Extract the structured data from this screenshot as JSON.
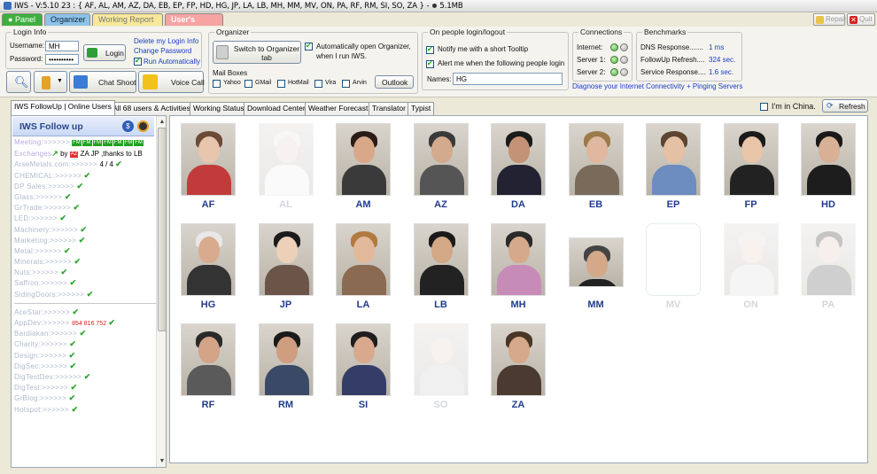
{
  "window": {
    "title": "IWS - V:5.10     23 : { AF, AL, AM, AZ, DA, EB, EP, FP, HD, HG, JP, LA, LB, MH, MM, MV, ON, PA, RF, RM, SI, SO, ZA }   -",
    "memory": "5.1MB",
    "repair": "Repair",
    "quit": "Quit"
  },
  "top_tabs": {
    "panel": "Panel",
    "organizer": "Organizer",
    "working_report": "Working Report",
    "users_manual": "User's Manual"
  },
  "login": {
    "group": "Login Info",
    "username_label": "Username:",
    "username_value": "MH",
    "password_label": "Password:",
    "password_value": "••••••••••",
    "login_button": "Login",
    "link_delete": "Delete my Login Info",
    "link_change": "Change Password",
    "run_auto": "Run Automatically"
  },
  "toolbar": {
    "chat_shoot": "Chat Shoot",
    "voice_call": "Voice Call"
  },
  "organizer": {
    "group": "Organizer",
    "switch_button": "Switch to Organizer tab",
    "auto_open": "Automatically open Organizer, when I run IWS.",
    "mailboxes_label": "Mail Boxes",
    "mailboxes": [
      "Yahoo",
      "GMail",
      "HotMail",
      "Vira",
      "Arvin"
    ],
    "outlook_button": "Outlook"
  },
  "people": {
    "group": "On people login/logout",
    "notify": "Notify me with a short Tooltip",
    "alert": "Alert me when the following people login",
    "names_label": "Names:",
    "names_value": "HG"
  },
  "connections": {
    "group": "Connections",
    "rows": [
      "Internet:",
      "Server 1:",
      "Server 2:"
    ]
  },
  "benchmarks": {
    "group": "Benchmarks",
    "rows": [
      {
        "label": "DNS Response.......",
        "value": "1 ms"
      },
      {
        "label": "FollowUp Refresh....",
        "value": "324 sec."
      },
      {
        "label": "Service Response....",
        "value": "1.6 sec."
      }
    ],
    "diagnose_link": "Diagnose your Internet Connectivity + Pinging Servers"
  },
  "lower_tabs": [
    "IWS FollowUp | Online Users",
    "All 68 users & Activities",
    "Working Status",
    "Download Center",
    "Weather Forecast",
    "Translator",
    "Typist"
  ],
  "china_label": "I'm in China.",
  "refresh_button": "Refresh",
  "followup": {
    "header": "IWS Follow up",
    "meeting_label": "Meeting:",
    "meeting_arrows": ">>>>>>",
    "exchanges_label": "Exchanges",
    "exchanges_text": " by ",
    "exchanges_badge": "AZ",
    "exchanges_rest": " ZA JP ,thanks to LB",
    "top_items": [
      {
        "label": "ArseMetals.com:",
        "value": "4 / 4"
      },
      {
        "label": "CHEMICAL:"
      },
      {
        "label": "DP Sales:"
      },
      {
        "label": "Glass:"
      },
      {
        "label": "GrTrade:"
      },
      {
        "label": "LED:"
      },
      {
        "label": "Machinery:"
      },
      {
        "label": "Marketing:"
      },
      {
        "label": "Metal:"
      },
      {
        "label": "Minerals:"
      },
      {
        "label": "Nuts:"
      },
      {
        "label": "Saffron:"
      },
      {
        "label": "SidingDoors:"
      }
    ],
    "bottom_items": [
      {
        "label": "AceStar:"
      },
      {
        "label": "AppDev:",
        "value": "854 816 752"
      },
      {
        "label": "Bardiakan:"
      },
      {
        "label": "Charity:"
      },
      {
        "label": "Design:"
      },
      {
        "label": "DigSec:"
      },
      {
        "label": "DigTestDev:"
      },
      {
        "label": "DigTest:"
      },
      {
        "label": "GrBlog:"
      },
      {
        "label": "Hotspot:"
      }
    ]
  },
  "users": [
    {
      "code": "AF",
      "online": true
    },
    {
      "code": "AL",
      "online": false
    },
    {
      "code": "AM",
      "online": true
    },
    {
      "code": "AZ",
      "online": true
    },
    {
      "code": "DA",
      "online": true
    },
    {
      "code": "EB",
      "online": true
    },
    {
      "code": "EP",
      "online": true
    },
    {
      "code": "FP",
      "online": true
    },
    {
      "code": "HD",
      "online": true
    },
    {
      "code": "HG",
      "online": true
    },
    {
      "code": "JP",
      "online": true
    },
    {
      "code": "LA",
      "online": true
    },
    {
      "code": "LB",
      "online": true
    },
    {
      "code": "MH",
      "online": true
    },
    {
      "code": "MM",
      "online": true
    },
    {
      "code": "MV",
      "online": false
    },
    {
      "code": "ON",
      "online": false
    },
    {
      "code": "PA",
      "online": false
    },
    {
      "code": "RF",
      "online": true
    },
    {
      "code": "RM",
      "online": true
    },
    {
      "code": "SI",
      "online": true
    },
    {
      "code": "SO",
      "online": false
    },
    {
      "code": "ZA",
      "online": true
    }
  ],
  "colors": {
    "accent_blue": "#213c8c",
    "link": "#1a3cc7",
    "online_green": "#2ea52e",
    "panel_tab": "#3fae3f"
  }
}
